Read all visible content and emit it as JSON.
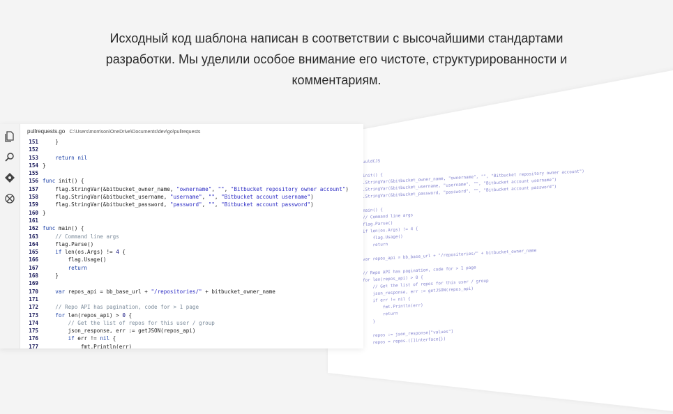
{
  "intro": {
    "text": "Исходный код шаблона написан в соответствии с высочайшими стандартами разработки. Мы уделили особое внимание его чистоте, структурированности и комментариям."
  },
  "editor": {
    "filename": "pullrequests.go",
    "path": "C:\\Users\\morrison\\OneDrive\\Documents\\dev\\go\\pullrequests",
    "activity_icons": [
      "files-icon",
      "search-icon",
      "source-control-icon",
      "extensions-icon"
    ],
    "lines": [
      {
        "n": "151",
        "html": "    }"
      },
      {
        "n": "152",
        "html": ""
      },
      {
        "n": "153",
        "html": "    return nil"
      },
      {
        "n": "154",
        "html": "}"
      },
      {
        "n": "155",
        "html": ""
      },
      {
        "n": "156",
        "html": "func init() {"
      },
      {
        "n": "157",
        "html": "    flag.StringVar(&bitbucket_owner_name, \"ownername\", \"\", \"Bitbucket repository owner account\")"
      },
      {
        "n": "158",
        "html": "    flag.StringVar(&bitbucket_username, \"username\", \"\", \"Bitbucket account username\")"
      },
      {
        "n": "159",
        "html": "    flag.StringVar(&bitbucket_password, \"password\", \"\", \"Bitbucket account password\")"
      },
      {
        "n": "160",
        "html": "}"
      },
      {
        "n": "161",
        "html": ""
      },
      {
        "n": "162",
        "html": "func main() {"
      },
      {
        "n": "163",
        "html": "    // Command line args"
      },
      {
        "n": "164",
        "html": "    flag.Parse()"
      },
      {
        "n": "165",
        "html": "    if len(os.Args) != 4 {"
      },
      {
        "n": "166",
        "html": "        flag.Usage()"
      },
      {
        "n": "167",
        "html": "        return"
      },
      {
        "n": "168",
        "html": "    }"
      },
      {
        "n": "169",
        "html": ""
      },
      {
        "n": "170",
        "html": "    var repos_api = bb_base_url + \"/repositories/\" + bitbucket_owner_name"
      },
      {
        "n": "171",
        "html": ""
      },
      {
        "n": "172",
        "html": "    // Repo API has pagination, code for > 1 page"
      },
      {
        "n": "173",
        "html": "    for len(repos_api) > 0 {"
      },
      {
        "n": "174",
        "html": "        // Get the list of repos for this user / group"
      },
      {
        "n": "175",
        "html": "        json_response, err := getJSON(repos_api)"
      },
      {
        "n": "176",
        "html": "        if err != nil {"
      },
      {
        "n": "177",
        "html": "            fmt.Println(err)"
      }
    ]
  },
  "back_editor": {
    "text": "uuldCJS\n\ninit() {\n.StringVar(&bitbucket_owner_name, \"ownername\", \"\", \"Bitbucket repository owner account\")\n.StringVar(&bitbucket_username, \"username\", \"\", \"Bitbucket account username\")\n.StringVar(&bitbucket_password, \"password\", \"\", \"Bitbucket account password\")\n\nmain() {\n// Command line args\nflag.Parse()\nif len(os.Args) != 4 {\n    flag.Usage()\n    return\n\nvar repos_api = bb_base_url + \"/repositories/\" + bitbucket_owner_name\n\n// Repo API has pagination, code for > 1 page\nfor len(repos_api) > 0 {\n    // Get the list of repos for this user / group\n    json_response, err := getJSON(repos_api)\n    if err != nil {\n        fmt.Println(err)\n        return\n    }\n\n    repos := json_response[\"values\"]\n    repos = repos.([]interface{})"
  }
}
